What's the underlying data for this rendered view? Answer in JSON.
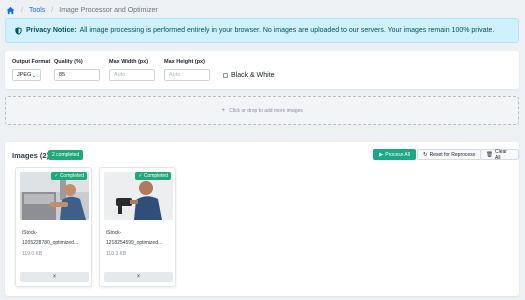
{
  "breadcrumb": {
    "tools": "Tools",
    "current": "Image Processor and Optimizer"
  },
  "notice": {
    "title": "Privacy Notice:",
    "text": "All image processing is performed entirely in your browser. No images are uploaded to our servers. Your images remain 100% private."
  },
  "settings": {
    "format": {
      "label": "Output Format",
      "value": "JPEG"
    },
    "quality": {
      "label": "Quality (%)",
      "value": "85"
    },
    "max_width": {
      "label": "Max Width (px)",
      "placeholder": "Auto"
    },
    "max_height": {
      "label": "Max Height (px)",
      "placeholder": "Auto"
    },
    "bw_label": "Black & White"
  },
  "dropzone": {
    "text": "Click or drop to add more images"
  },
  "images": {
    "title": "Images (2)",
    "completed_badge": "2 completed",
    "process_all": "Process All",
    "reset": "Reset for Reprocess",
    "clear_all": "Clear All",
    "items": [
      {
        "status": "✓ Completed",
        "name_line1": "iStock-",
        "name_line2": "1205228780_optimized...",
        "size": "119.0 KB",
        "remove": "×"
      },
      {
        "status": "✓ Completed",
        "name_line1": "iStock-",
        "name_line2": "1218254599_optimized...",
        "size": "110.3 KB",
        "remove": "×"
      }
    ]
  },
  "colors": {
    "accent": "#0d6efd",
    "success": "#1fa97a",
    "notice_bg": "#cff1fc"
  }
}
